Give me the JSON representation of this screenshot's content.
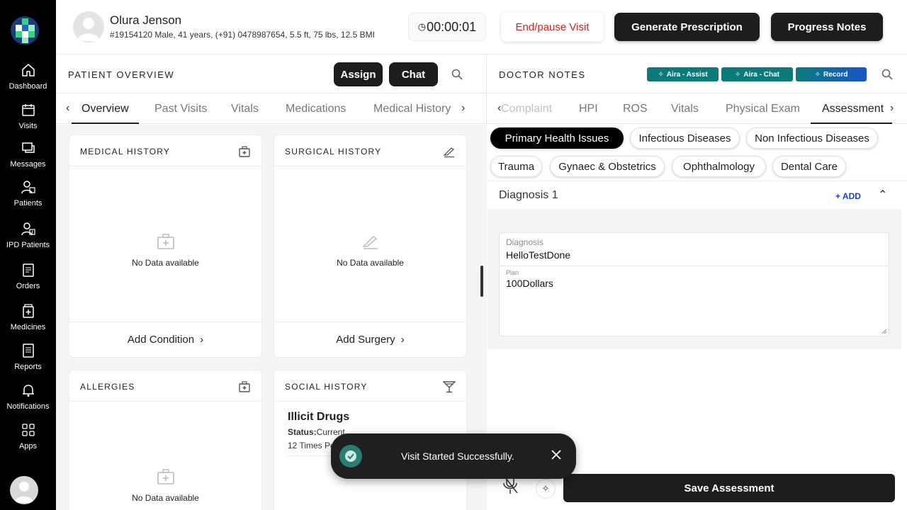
{
  "sidebar": {
    "items": [
      {
        "label": "Dashboard",
        "icon": "home-icon"
      },
      {
        "label": "Visits",
        "icon": "calendar-icon"
      },
      {
        "label": "Messages",
        "icon": "messages-icon"
      },
      {
        "label": "Patients",
        "icon": "patient-icon"
      },
      {
        "label": "IPD Patients",
        "icon": "ipd-patient-icon"
      },
      {
        "label": "Orders",
        "icon": "orders-icon"
      },
      {
        "label": "Medicines",
        "icon": "medicine-icon"
      },
      {
        "label": "Reports",
        "icon": "reports-icon"
      },
      {
        "label": "Notifications",
        "icon": "bell-icon"
      },
      {
        "label": "Apps",
        "icon": "apps-grid-icon"
      }
    ]
  },
  "header": {
    "patient_name": "Olura Jenson",
    "patient_meta": "#19154120 Male, 41 years, (+91) 0478987654, 5.5 ft, 75 lbs, 12.5 BMI",
    "timer": "00:00:01",
    "end_visit": "End/pause Visit",
    "generate_prescription": "Generate Prescription",
    "progress_notes": "Progress Notes"
  },
  "overview": {
    "title": "PATIENT OVERVIEW",
    "assign": "Assign",
    "chat": "Chat",
    "tabs": [
      "Overview",
      "Past Visits",
      "Vitals",
      "Medications",
      "Medical History"
    ],
    "active_tab": "Overview",
    "cards": {
      "medical_history": {
        "title": "MEDICAL HISTORY",
        "empty": "No Data available",
        "action": "Add Condition"
      },
      "surgical_history": {
        "title": "SURGICAL HISTORY",
        "empty": "No Data available",
        "action": "Add Surgery"
      },
      "allergies": {
        "title": "ALLERGIES",
        "empty": "No Data available"
      },
      "social_history": {
        "title": "SOCIAL HISTORY",
        "item_title": "Illicit Drugs",
        "status_label": "Status:",
        "status_value": "Current",
        "detail": "12 Times Per Week x 7 years"
      }
    }
  },
  "notes": {
    "title": "DOCTOR NOTES",
    "aira_assist": "Aira - Assist",
    "aira_chat": "Aira - Chat",
    "record": "Record",
    "tabs": [
      "Complaint",
      "HPI",
      "ROS",
      "Vitals",
      "Physical Exam",
      "Assessment"
    ],
    "active_tab": "Assessment",
    "categories": [
      "Primary Health Issues",
      "Infectious Diseases",
      "Non Infectious Diseases",
      "Trauma",
      "Gynaec & Obstetrics",
      "Ophthalmology",
      "Dental Care"
    ],
    "selected_category": "Primary Health Issues",
    "diagnosis_heading": "Diagnosis 1",
    "add": "+ ADD",
    "diagnosis_label": "Diagnosis",
    "diagnosis_value": "HelloTestDone",
    "plan_label": "Plan",
    "plan_value": "100Dollars",
    "save": "Save Assessment"
  },
  "toast": {
    "message": "Visit Started Successfully."
  },
  "colors": {
    "sidebar_bg": "#000000",
    "accent_dark": "#1d1d1d",
    "danger": "#e01e1e",
    "aira_teal": "#0c7a7a",
    "link_blue": "#1a3fd0"
  }
}
